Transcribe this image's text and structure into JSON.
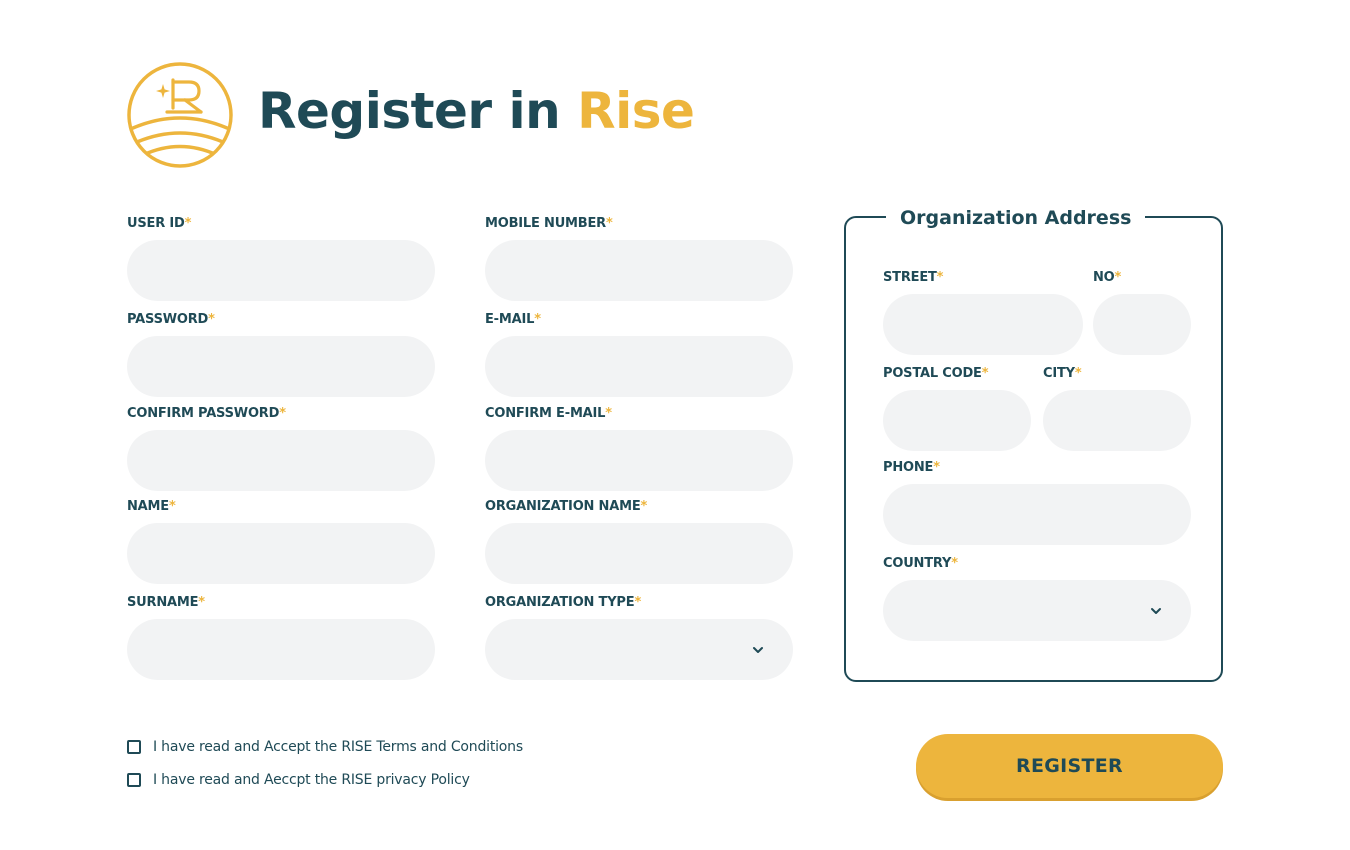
{
  "header": {
    "title_main": "Register in ",
    "title_accent": "Rise"
  },
  "colors": {
    "primary": "#1f4a56",
    "accent": "#edb53d",
    "input_bg": "#f2f3f4"
  },
  "required_mark": "*",
  "form": {
    "user_id": {
      "label": "USER ID",
      "value": ""
    },
    "password": {
      "label": "PASSWORD",
      "value": ""
    },
    "confirm_password": {
      "label": "CONFIRM PASSWORD",
      "value": ""
    },
    "name": {
      "label": "NAME",
      "value": ""
    },
    "surname": {
      "label": "SURNAME",
      "value": ""
    },
    "mobile_number": {
      "label": "MOBILE NUMBER",
      "value": ""
    },
    "email": {
      "label": "E-MAIL",
      "value": ""
    },
    "confirm_email": {
      "label": "CONFIRM E-MAIL",
      "value": ""
    },
    "organization_name": {
      "label": "ORGANIZATION NAME",
      "value": ""
    },
    "organization_type": {
      "label": "ORGANIZATION TYPE",
      "selected": ""
    }
  },
  "address": {
    "legend": "Organization Address",
    "street": {
      "label": "STREET",
      "value": ""
    },
    "no": {
      "label": "NO",
      "value": ""
    },
    "postal_code": {
      "label": "POSTAL CODE",
      "value": ""
    },
    "city": {
      "label": "CITY",
      "value": ""
    },
    "phone": {
      "label": "PHONE",
      "value": ""
    },
    "country": {
      "label": "COUNTRY",
      "selected": ""
    }
  },
  "agreements": {
    "terms": "I have read and Accept the RISE Terms and Conditions",
    "privacy": "I have read and Aeccpt the RISE privacy Policy"
  },
  "actions": {
    "register": "REGISTER"
  },
  "icons": {
    "logo": "rise-logo-icon",
    "chevron": "chevron-down-icon"
  }
}
